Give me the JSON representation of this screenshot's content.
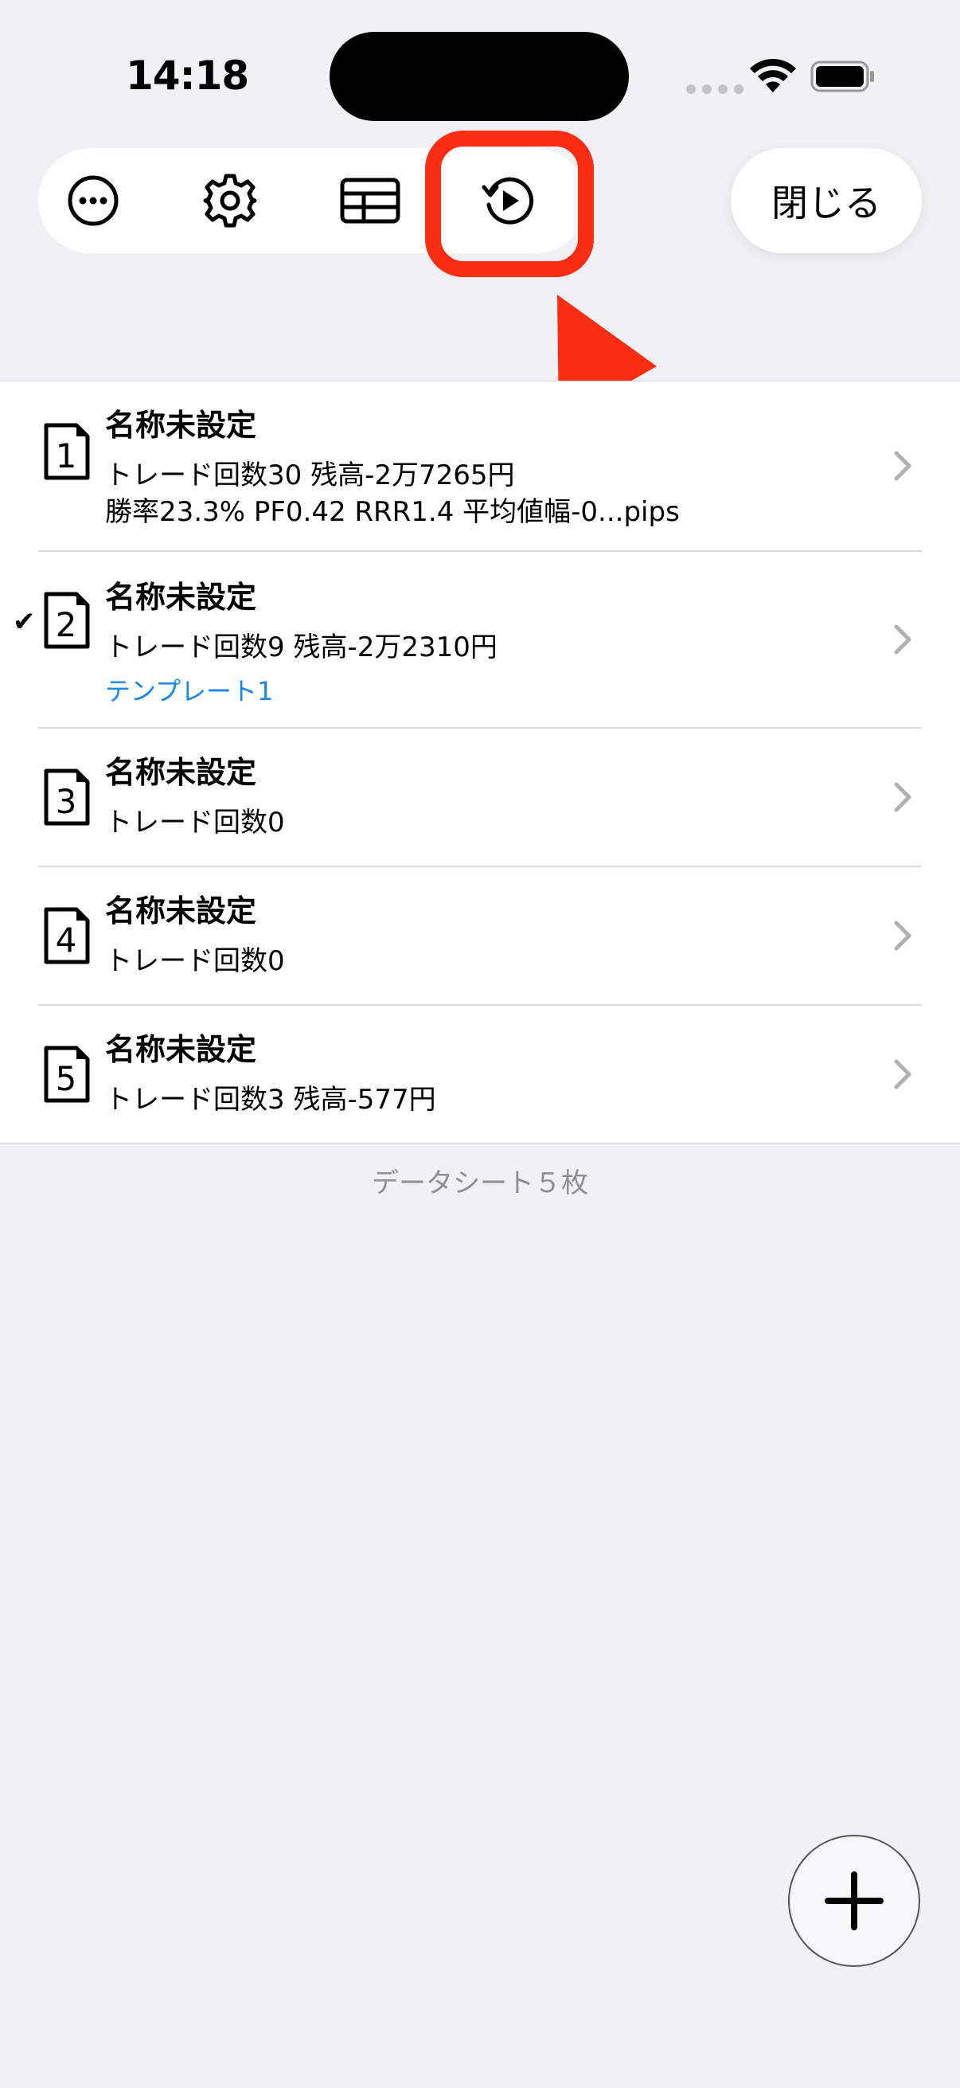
{
  "status": {
    "time": "14:18"
  },
  "toolbar": {
    "more_icon": "ellipsis-circle-icon",
    "settings_icon": "gear-icon",
    "table_icon": "table-icon",
    "replay_icon": "replay-play-icon",
    "close_label": "閉じる"
  },
  "sheets": [
    {
      "number": "1",
      "title": "名称未設定",
      "line1": "トレード回数30 残高-2万7265円",
      "line2": "勝率23.3% PF0.42 RRR1.4 平均値幅-0...pips",
      "selected": false
    },
    {
      "number": "2",
      "title": "名称未設定",
      "line1": "トレード回数9 残高-2万2310円",
      "template": "テンプレート1",
      "selected": true
    },
    {
      "number": "3",
      "title": "名称未設定",
      "line1": "トレード回数0",
      "selected": false
    },
    {
      "number": "4",
      "title": "名称未設定",
      "line1": "トレード回数0",
      "selected": false
    },
    {
      "number": "5",
      "title": "名称未設定",
      "line1": "トレード回数3 残高-577円",
      "selected": false
    }
  ],
  "footer": {
    "count_label": "データシート５枚"
  },
  "colors": {
    "highlight": "#fb2d13",
    "template_link": "#1a87e8",
    "background": "#f0f0f5"
  },
  "checkmark": "✔"
}
